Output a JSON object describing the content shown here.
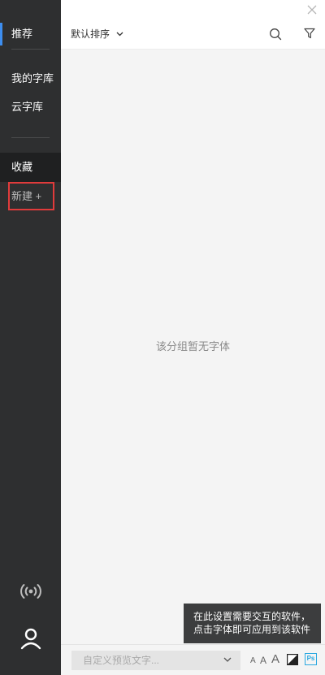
{
  "sidebar": {
    "items": [
      {
        "label": "推荐"
      },
      {
        "label": "我的字库"
      },
      {
        "label": "云字库"
      },
      {
        "label": "收藏"
      }
    ],
    "new_label": "新建 +",
    "icons": [
      "broadcast-icon",
      "user-icon"
    ]
  },
  "topbar": {
    "sort_label": "默认排序",
    "icons": [
      "close-icon",
      "search-icon",
      "filter-icon"
    ]
  },
  "main": {
    "empty_text": "该分组暂无字体"
  },
  "tooltip": {
    "line1": "在此设置需要交互的软件，",
    "line2": "点击字体即可应用到该软件"
  },
  "bottombar": {
    "preview_placeholder": "自定义预览文字...",
    "size_small": "A",
    "size_medium": "A",
    "size_large": "A",
    "ps_label": "Ps"
  },
  "colors": {
    "sidebar_bg": "#2e2f30",
    "accent": "#3d8ef0",
    "highlight_border": "#e03b3b",
    "ps_blue": "#29a8e0"
  }
}
